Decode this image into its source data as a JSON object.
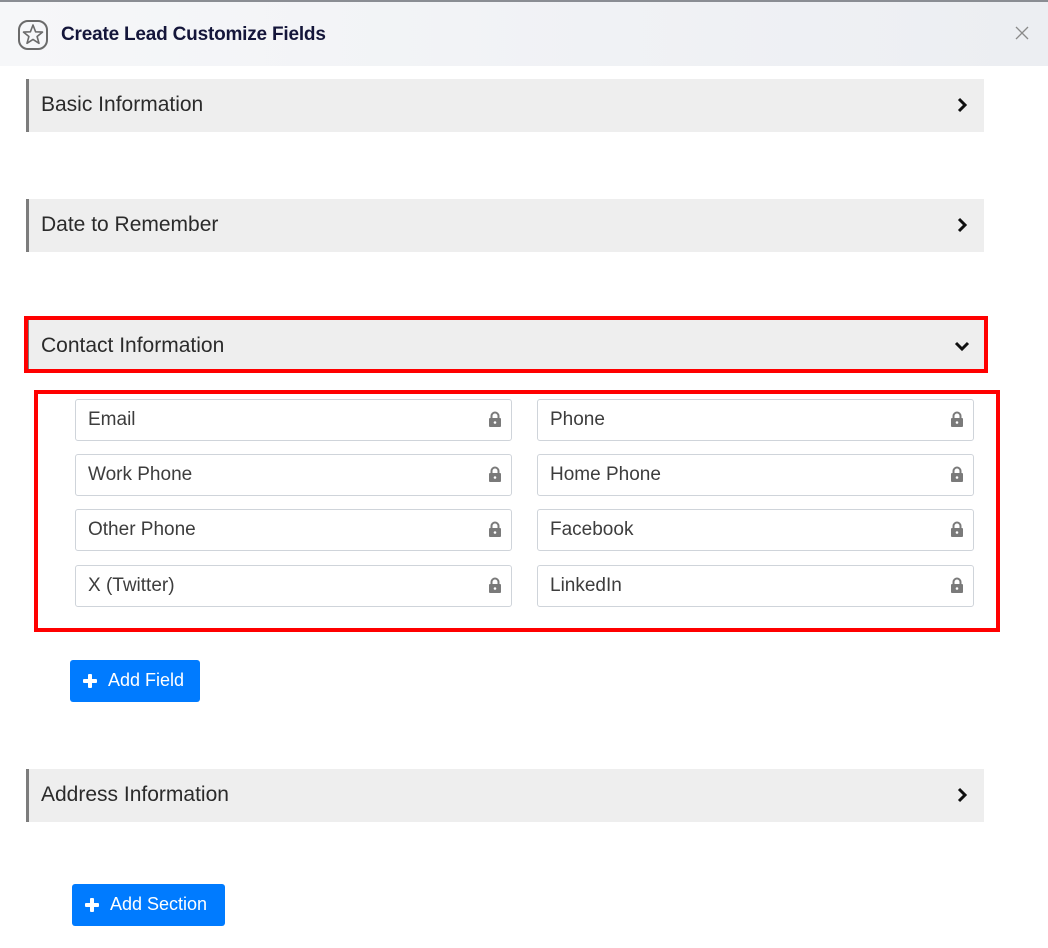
{
  "dialog": {
    "title": "Create Lead Customize Fields",
    "logo_icon": "star-badge-icon",
    "close_icon": "close-icon"
  },
  "sections": [
    {
      "label": "Basic Information",
      "state": "collapsed"
    },
    {
      "label": "Date to Remember",
      "state": "collapsed"
    },
    {
      "label": "Contact Information",
      "state": "expanded"
    },
    {
      "label": "Address Information",
      "state": "collapsed"
    }
  ],
  "contact_fields": [
    {
      "label": "Email",
      "locked": true
    },
    {
      "label": "Phone",
      "locked": true
    },
    {
      "label": "Work Phone",
      "locked": true
    },
    {
      "label": "Home Phone",
      "locked": true
    },
    {
      "label": "Other Phone",
      "locked": true
    },
    {
      "label": "Facebook",
      "locked": true
    },
    {
      "label": "X (Twitter)",
      "locked": true
    },
    {
      "label": "LinkedIn",
      "locked": true
    }
  ],
  "buttons": {
    "add_field": "Add Field",
    "add_section": "Add Section"
  },
  "colors": {
    "primary": "#007bff",
    "highlight": "#ff0000",
    "section_bg": "#eeeeee"
  }
}
